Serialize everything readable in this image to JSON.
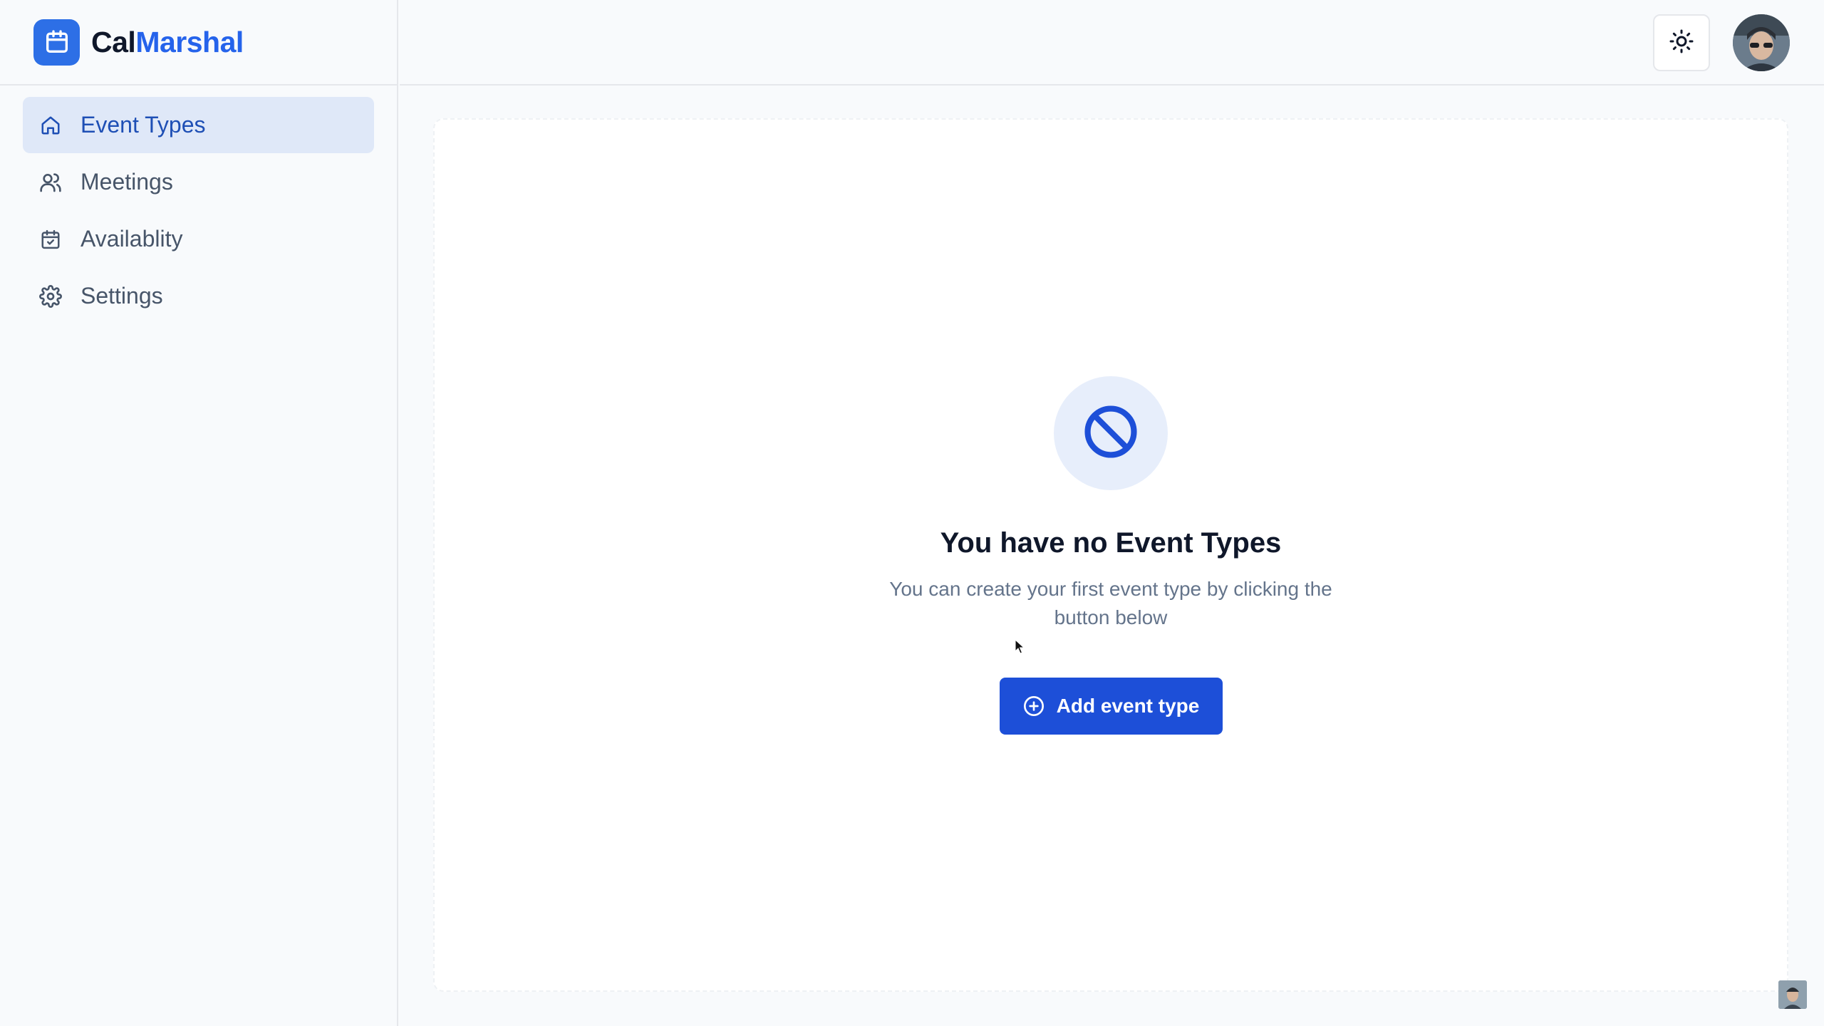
{
  "brand": {
    "part1": "Cal",
    "part2": "Marshal"
  },
  "sidebar": {
    "items": [
      {
        "label": "Event Types",
        "icon": "home-icon",
        "active": true
      },
      {
        "label": "Meetings",
        "icon": "users-icon"
      },
      {
        "label": "Availablity",
        "icon": "calendar-check-icon"
      },
      {
        "label": "Settings",
        "icon": "gear-icon"
      }
    ]
  },
  "topbar": {
    "theme_toggle_icon": "sun-icon",
    "avatar": "user-avatar"
  },
  "empty_state": {
    "icon": "ban-icon",
    "title": "You have no Event Types",
    "description": "You can create your first event type by clicking the button below",
    "button_label": "Add event type",
    "button_icon": "plus-circle-icon"
  },
  "colors": {
    "accent": "#1d4fd8",
    "brand_accent": "#2563eb",
    "active_nav_bg": "#dfe8f8",
    "icon_bg": "#e7eefb"
  }
}
